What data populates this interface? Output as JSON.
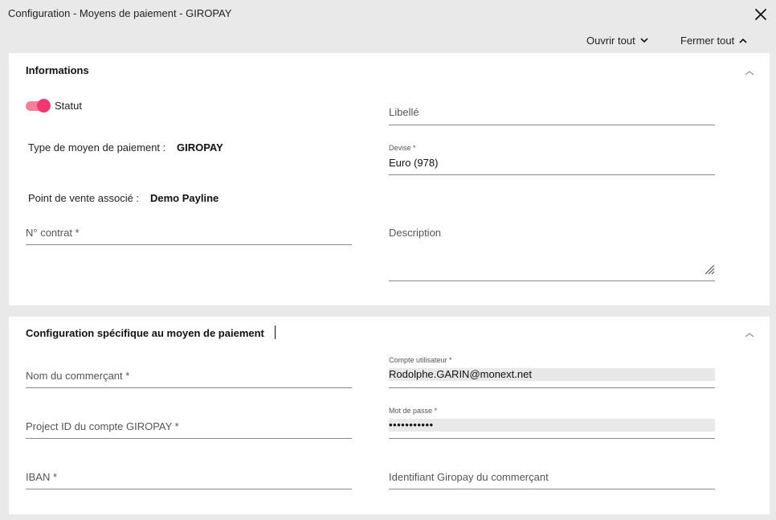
{
  "window": {
    "title": "Configuration - Moyens de paiement - GIROPAY"
  },
  "toolbar": {
    "open_all": "Ouvrir tout",
    "close_all": "Fermer tout"
  },
  "informations": {
    "title": "Informations",
    "status_label": "Statut",
    "status_on": true,
    "type_label": "Type de moyen de paiement :",
    "type_value": "GIROPAY",
    "pos_label": "Point de vente associé :",
    "pos_value": "Demo Payline",
    "libelle": {
      "placeholder": "Libellé",
      "value": ""
    },
    "devise": {
      "label": "Devise *",
      "value": "Euro (978)"
    },
    "contract": {
      "placeholder": "N° contrat *",
      "value": ""
    },
    "description": {
      "placeholder": "Description",
      "value": ""
    }
  },
  "config": {
    "title": "Configuration spécifique au moyen de paiement",
    "merchant_name": {
      "placeholder": "Nom du commerçant *",
      "value": ""
    },
    "user_account": {
      "label": "Compte utilisateur *",
      "value": "Rodolphe.GARIN@monext.net"
    },
    "project_id": {
      "placeholder": "Project ID du compte GIROPAY *",
      "value": ""
    },
    "password": {
      "label": "Mot de passe *",
      "value": "•••••••••••"
    },
    "iban": {
      "placeholder": "IBAN *",
      "value": ""
    },
    "giropay_id": {
      "placeholder": "Identifiant Giropay du commerçant",
      "value": ""
    }
  },
  "colors": {
    "accent": "#f0386e",
    "accent_light": "#f57e9a",
    "background": "#e8e9e8"
  },
  "icons": [
    "close-icon",
    "chevron-down-icon",
    "chevron-up-icon",
    "resize-icon"
  ]
}
